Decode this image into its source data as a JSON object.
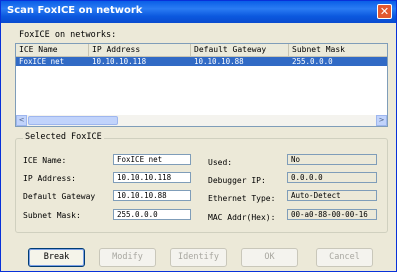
{
  "window": {
    "title": "Scan FoxICE on network",
    "close_glyph": "✕"
  },
  "networks_label": "FoxICE on networks:",
  "list": {
    "columns": [
      "ICE Name",
      "IP Address",
      "Default Gateway",
      "Subnet Mask"
    ],
    "rows": [
      {
        "name": "FoxICE net",
        "ip": "10.10.10.118",
        "gateway": "10.10.10.88",
        "mask": "255.0.0.0"
      }
    ],
    "scroll_left_glyph": "<",
    "scroll_right_glyph": ">"
  },
  "selected": {
    "group_label": "Selected FoxICE",
    "ice_name": {
      "label": "ICE Name:",
      "value": "FoxICE net"
    },
    "ip_address": {
      "label": "IP Address:",
      "value": "10.10.10.118"
    },
    "default_gateway": {
      "label": "Default Gateway",
      "value": "10.10.10.88"
    },
    "subnet_mask": {
      "label": "Subnet Mask:",
      "value": "255.0.0.0"
    },
    "used": {
      "label": "Used:",
      "value": "No"
    },
    "debugger_ip": {
      "label": "Debugger IP:",
      "value": "0.0.0.0"
    },
    "ethernet_type": {
      "label": "Ethernet Type:",
      "value": "Auto-Detect"
    },
    "mac_addr": {
      "label": "MAC Addr(Hex):",
      "value": "00-a0-88-00-00-16"
    }
  },
  "buttons": {
    "break": "Break",
    "modify": "Modify",
    "identify": "Identify",
    "ok": "OK",
    "cancel": "Cancel"
  },
  "colors": {
    "titlebar": "#0a5ee7",
    "selection": "#316ac5",
    "dialog": "#ece9d8"
  },
  "icons": {
    "close": "close-icon"
  }
}
